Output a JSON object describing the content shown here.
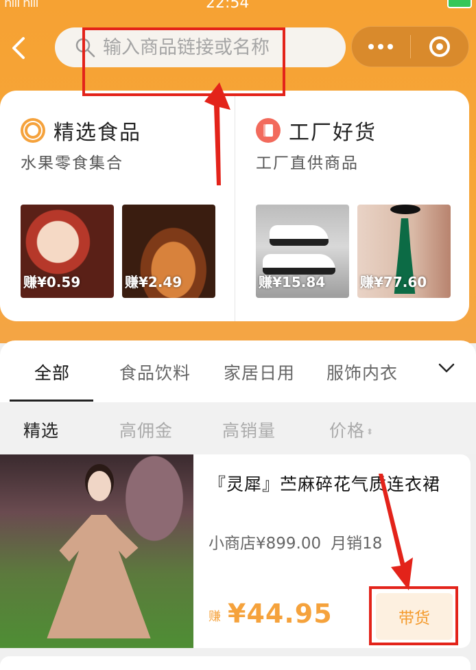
{
  "status_bar": {
    "signal": "nlll nlll",
    "time": "22:54"
  },
  "search": {
    "placeholder": "输入商品链接或名称"
  },
  "sections": [
    {
      "title": "精选食品",
      "subtitle": "水果零食集合",
      "items": [
        {
          "earn": "赚¥0.59"
        },
        {
          "earn": "赚¥2.49"
        }
      ]
    },
    {
      "title": "工厂好货",
      "subtitle": "工厂直供商品",
      "items": [
        {
          "earn": "赚¥15.84"
        },
        {
          "earn": "赚¥77.60"
        }
      ]
    }
  ],
  "tabs": [
    "全部",
    "食品饮料",
    "家居日用",
    "服饰内衣"
  ],
  "filters": [
    "精选",
    "高佣金",
    "高销量",
    "价格"
  ],
  "product": {
    "name": "『灵犀』苎麻碎花气质连衣裙",
    "store_price": "小商店¥899.00",
    "monthly_sales": "月销18",
    "earn_label": "赚",
    "earn_price": "¥44.95",
    "cta_label": "带货"
  },
  "colors": {
    "accent": "#f5a23c",
    "annotation_red": "#e3231a"
  }
}
